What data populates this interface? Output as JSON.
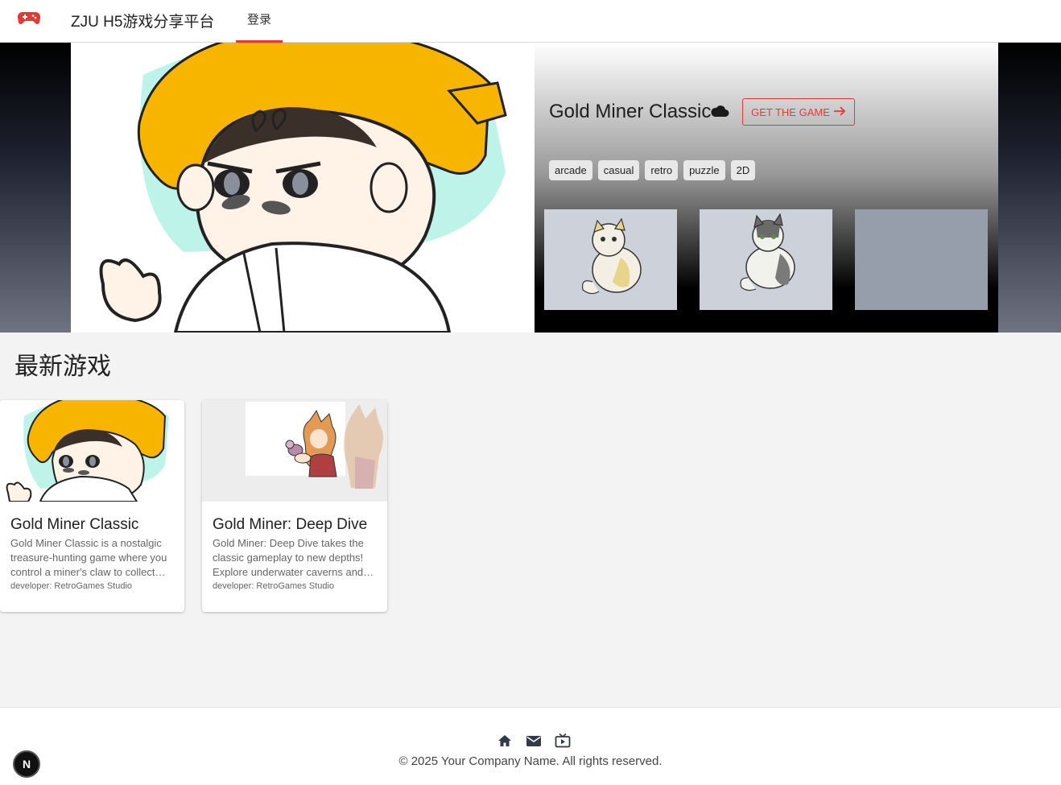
{
  "header": {
    "site_title": "ZJU H5游戏分享平台",
    "nav_login": "登录",
    "logo_icon": "gamepad-icon",
    "accent_color": "#e53935"
  },
  "hero": {
    "game_title": "Gold Miner Classic",
    "cloud_icon": "cloud-icon",
    "get_game_label": "GET THE GAME",
    "arrow_icon": "arrow-right-icon",
    "tags": [
      "arcade",
      "casual",
      "retro",
      "puzzle",
      "2D"
    ]
  },
  "latest": {
    "section_title": "最新游戏",
    "cards": [
      {
        "title": "Gold Miner Classic",
        "description": "Gold Miner Classic is a nostalgic treasure-hunting game where you control a miner's claw to collect gold and treasures.",
        "developer": "developer: RetroGames Studio"
      },
      {
        "title": "Gold Miner: Deep Dive",
        "description": "Gold Miner: Deep Dive takes the classic gameplay to new depths! Explore underwater caverns and discover hidden treasures.",
        "developer": "developer: RetroGames Studio"
      }
    ]
  },
  "footer": {
    "icons": [
      "home-icon",
      "mail-icon",
      "tv-icon"
    ],
    "copyright": "© 2025 Your Company Name. All rights reserved."
  },
  "dev_badge": "N"
}
